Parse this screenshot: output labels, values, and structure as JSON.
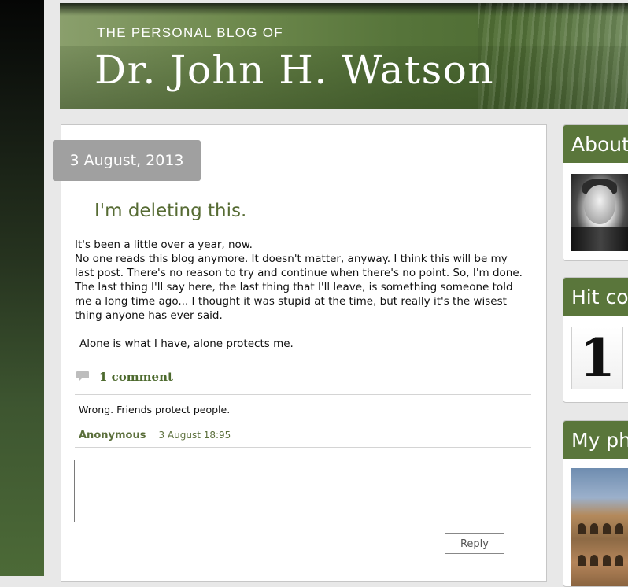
{
  "banner": {
    "subtitle": "THE PERSONAL BLOG OF",
    "title": "Dr. John H. Watson"
  },
  "post": {
    "date": "3 August, 2013",
    "title": "I'm deleting this.",
    "body_lines": [
      "It's been a little over a year, now.",
      "No one reads this blog anymore. It doesn't matter, anyway. I think this will be my last post. There's no reason to try and continue when there's no point. So, I'm done. The last thing I'll say here, the last thing that I'll leave, is something someone told me a long time ago... I thought it was stupid at the time, but really it's the wisest thing anyone has ever said.",
      "Alone is what I have, alone protects me."
    ]
  },
  "comments": {
    "count_label": "1 comment",
    "items": [
      {
        "text": "Wrong. Friends protect people.",
        "author": "Anonymous",
        "date": "3 August 18:95"
      }
    ],
    "reply_label": "Reply"
  },
  "sidebar": {
    "about_title": "About",
    "hit_title": "Hit co",
    "hit_count": "1",
    "photos_title": "My ph"
  },
  "colors": {
    "accent_green": "#5a763b",
    "title_green": "#566b33",
    "date_badge_gray": "#a0a0a0"
  },
  "icons": {
    "comment": "speech-bubble-icon"
  }
}
